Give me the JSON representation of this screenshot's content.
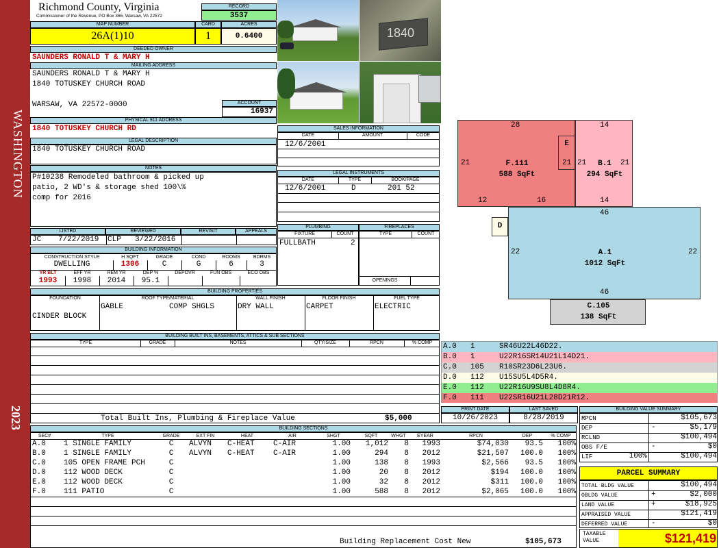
{
  "sidebar": {
    "district": "WASHINGTON",
    "year": "2023"
  },
  "header": {
    "county": "Richmond County, Virginia",
    "commissioner": "Commissioner of the Revenue, PO Box 366, Warsaw, VA 22572",
    "record_label": "RECORD",
    "record": "3537",
    "map_label": "MAP NUMBER",
    "map_number": "26A(1)10",
    "card_label": "CARD",
    "card": "1",
    "acres_label": "ACRES",
    "acres": "0.6400"
  },
  "owner": {
    "deeded_label": "DEEDED OWNER",
    "deeded_owner": "SAUNDERS RONALD T & MARY H",
    "mailing_label": "MAILING ADDRESS",
    "mailing": [
      "SAUNDERS RONALD T & MARY H",
      "1840 TOTUSKEY CHURCH ROAD",
      "WARSAW, VA 22572-0000"
    ],
    "account_label": "ACCOUNT",
    "account": "16937",
    "physical_label": "PHYSICAL 911 ADDRESS",
    "physical": "1840 TOTUSKEY CHURCH RD",
    "legal_label": "LEGAL DESCRIPTION",
    "legal": "1840 TOTUSKEY CHURCH ROAD",
    "notes_label": "NOTES",
    "notes": [
      "P#10238 Remodeled bathroom & picked up",
      "patio, 2 WD's & storage shed 100\\%",
      "comp for 2016"
    ]
  },
  "photos": {
    "sign_number": "1840"
  },
  "sales": {
    "label": "SALES INFORMATION",
    "headers": [
      "DATE",
      "AMOUNT",
      "CODE"
    ],
    "rows": [
      [
        "12/6/2001",
        "",
        ""
      ]
    ]
  },
  "legal_instruments": {
    "label": "LEGAL INSTRUMENTS",
    "headers": [
      "DATE",
      "TYPE",
      "BOOK/PAGE"
    ],
    "rows": [
      [
        "12/6/2001",
        "D",
        "201 52"
      ]
    ]
  },
  "listing": {
    "headers": [
      "LISTED",
      "REVIEWED",
      "REVISIT",
      "APPEALS"
    ],
    "listed_by": "JC",
    "listed_date": "7/22/2019",
    "reviewed_by": "CLP",
    "reviewed_date": "3/22/2016"
  },
  "building_info": {
    "label": "BUILDING INFORMATION",
    "headers1": [
      "CONSTRUCTION STYLE",
      "H SQFT",
      "GRADE",
      "COND",
      "ROOMS",
      "BDRMS"
    ],
    "values1": [
      "DWELLING",
      "1306",
      "C",
      "G",
      "6",
      "3"
    ],
    "headers2": [
      "YR BLT",
      "EFF YR",
      "REM YR",
      "DEP %",
      "DEPOVR",
      "FUN OBS",
      "ECO OBS"
    ],
    "values2": [
      "1993",
      "1998",
      "2014",
      "95.1",
      "",
      "",
      ""
    ]
  },
  "plumbing": {
    "label": "PLUMBING",
    "headers": [
      "FIXTURE",
      "COUNT"
    ],
    "rows": [
      [
        "FULLBATH",
        "2"
      ]
    ]
  },
  "fireplaces": {
    "label": "FIREPLACES",
    "headers": [
      "TYPE",
      "COUNT"
    ],
    "openings_label": "OPENINGS"
  },
  "properties": {
    "label": "BUILDING PROPERTIES",
    "headers": [
      "FOUNDATION",
      "ROOF TYPE/MATERIAL",
      "WALL FINISH",
      "FLOOR FINISH",
      "FUEL TYPE"
    ],
    "foundation": "CINDER BLOCK",
    "roof_type": "GABLE",
    "roof_material": "COMP SHGLS",
    "wall": "DRY WALL",
    "floor": "CARPET",
    "fuel": "ELECTRIC"
  },
  "builtins": {
    "label": "BUILDING BUILT INS, BASEMENTS, ATTICS & SUB SECTIONS",
    "headers": [
      "TYPE",
      "GRADE",
      "NOTES",
      "QTY/SIZE",
      "RPCN",
      "% COMP"
    ],
    "total_label": "Total Built Ins, Plumbing & Fireplace Value",
    "total_value": "$5,000"
  },
  "sketch": {
    "F": {
      "label": "F.111",
      "area": "588 SqFt",
      "top": "28",
      "left": "21",
      "right": "21",
      "b1": "12",
      "b2": "16"
    },
    "E": {
      "label": "E"
    },
    "B": {
      "label": "B.1",
      "area": "294 SqFt",
      "top": "14",
      "left": "21",
      "right": "21",
      "bottom": "14"
    },
    "D": {
      "label": "D"
    },
    "A": {
      "label": "A.1",
      "area": "1012 SqFt",
      "top": "46",
      "left": "22",
      "right": "22",
      "bottom": "46"
    },
    "C": {
      "label": "C.105",
      "area": "138 SqFt"
    }
  },
  "sketch_legend": [
    {
      "code": "A.0",
      "num": "1",
      "vector": "SR46U22L46D22.",
      "color": "#add8e6"
    },
    {
      "code": "B.0",
      "num": "1",
      "vector": "U22R16SR14U21L14D21.",
      "color": "#ffb6c1"
    },
    {
      "code": "C.0",
      "num": "105",
      "vector": "R10SR23D6L23U6.",
      "color": "#d3d3d3"
    },
    {
      "code": "D.0",
      "num": "112",
      "vector": "U15SU5L4D5R4.",
      "color": "#fffbe6"
    },
    {
      "code": "E.0",
      "num": "112",
      "vector": "U22R16U9SU8L4D8R4.",
      "color": "#90ee90"
    },
    {
      "code": "F.0",
      "num": "111",
      "vector": "U22SR16U21L28D21R12.",
      "color": "#f08080"
    }
  ],
  "print_info": {
    "print_label": "PRINT DATE",
    "print_date": "10/26/2023",
    "saved_label": "LAST SAVED",
    "saved_date": "8/28/2019"
  },
  "value_summary": {
    "label": "BUILDING VALUE SUMMARY",
    "rows": [
      {
        "k": "RPCN",
        "sign": "",
        "v": "$105,673"
      },
      {
        "k": "DEP",
        "sign": "-",
        "v": "$5,179"
      },
      {
        "k": "RCLND",
        "sign": "",
        "v": "$100,494"
      },
      {
        "k": "OBS F/E",
        "sign": "-",
        "v": "$0"
      },
      {
        "k": "LIF",
        "sign": "100%",
        "v": "$100,494"
      }
    ]
  },
  "parcel_summary": {
    "label": "PARCEL SUMMARY",
    "rows": [
      {
        "k": "TOTAL BLDG VALUE",
        "sign": "",
        "v": "$100,494"
      },
      {
        "k": "OBLDG VALUE",
        "sign": "+",
        "v": "$2,000"
      },
      {
        "k": "LAND VALUE",
        "sign": "+",
        "v": "$18,925"
      },
      {
        "k": "APPRAISED VALUE",
        "sign": "",
        "v": "$121,419"
      },
      {
        "k": "DEFERRED VALUE",
        "sign": "-",
        "v": "$0"
      }
    ],
    "taxable_label": "TAXABLE VALUE",
    "taxable": "$121,419"
  },
  "sections": {
    "label": "BUILDING SECTIONS",
    "headers": [
      "SEC#",
      "TYPE",
      "GRADE",
      "EXT FIN",
      "HEAT",
      "AIR",
      "SHGT",
      "SQFT",
      "WHGT",
      "EYEAR",
      "RPCN",
      "DEP",
      "% COMP"
    ],
    "rows": [
      [
        "A.0",
        "1 SINGLE FAMILY",
        "C",
        "ALVYN",
        "C-HEAT",
        "C-AIR",
        "1.00",
        "1,012",
        "8",
        "1993",
        "$74,030",
        "93.5",
        "100%"
      ],
      [
        "B.0",
        "1 SINGLE FAMILY",
        "C",
        "ALVYN",
        "C-HEAT",
        "C-AIR",
        "1.00",
        "294",
        "8",
        "2012",
        "$21,507",
        "100.0",
        "100%"
      ],
      [
        "C.0",
        "105 OPEN FRAME PCH",
        "C",
        "",
        "",
        "",
        "1.00",
        "138",
        "8",
        "1993",
        "$2,566",
        "93.5",
        "100%"
      ],
      [
        "D.0",
        "112 WOOD DECK",
        "C",
        "",
        "",
        "",
        "1.00",
        "20",
        "8",
        "2012",
        "$194",
        "100.0",
        "100%"
      ],
      [
        "E.0",
        "112 WOOD DECK",
        "C",
        "",
        "",
        "",
        "1.00",
        "32",
        "8",
        "2012",
        "$311",
        "100.0",
        "100%"
      ],
      [
        "F.0",
        "111 PATIO",
        "C",
        "",
        "",
        "",
        "1.00",
        "588",
        "8",
        "2012",
        "$2,065",
        "100.0",
        "100%"
      ]
    ],
    "replacement_label": "Building Replacement Cost New",
    "replacement_value": "$105,673"
  }
}
